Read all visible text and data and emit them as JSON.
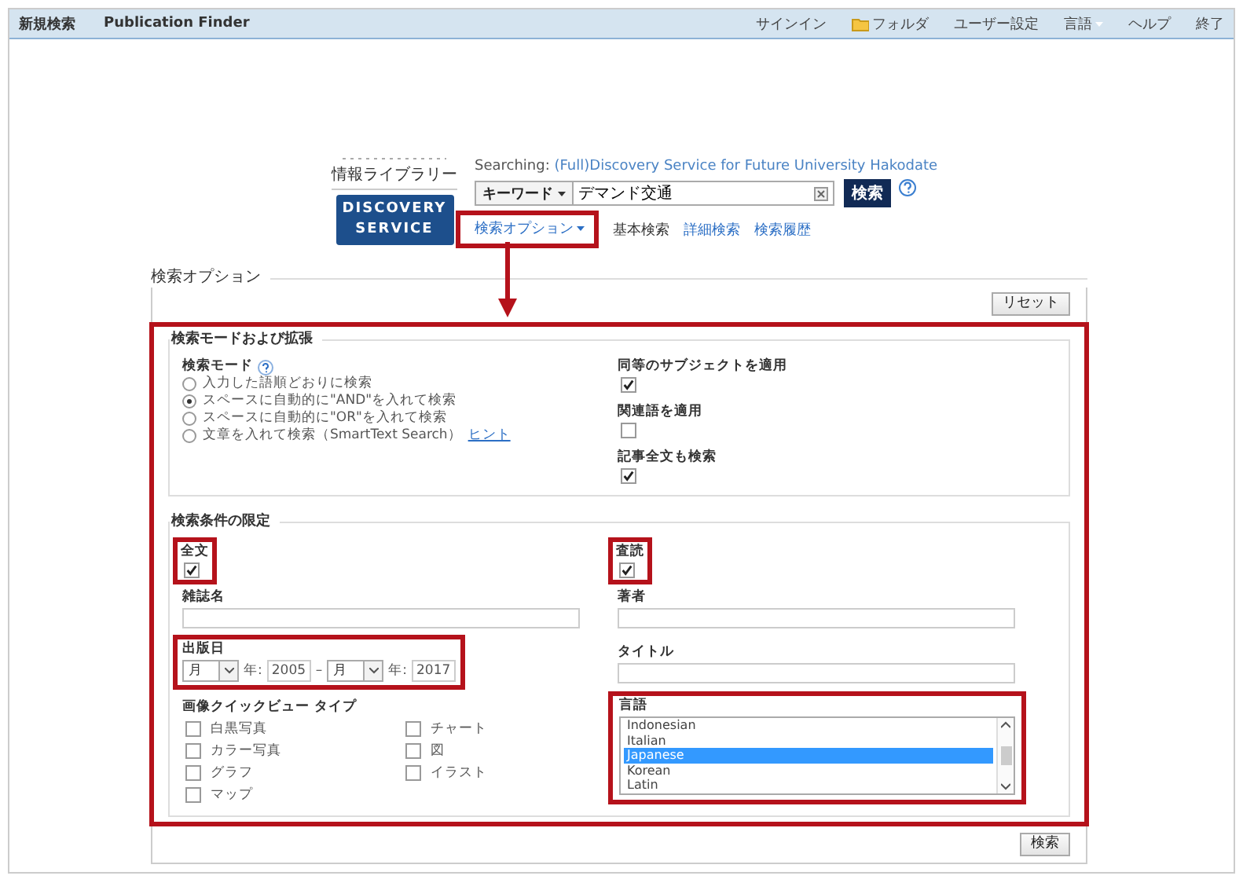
{
  "top_bar": {
    "left_links": [
      "新規検索",
      "Publication Finder"
    ],
    "right_links": [
      {
        "label": "サインイン",
        "kind": "plain"
      },
      {
        "label": "フォルダ",
        "kind": "folder"
      },
      {
        "label": "ユーザー設定",
        "kind": "plain"
      },
      {
        "label": "言語",
        "kind": "menu"
      },
      {
        "label": "ヘルプ",
        "kind": "plain"
      },
      {
        "label": "終了",
        "kind": "plain"
      }
    ]
  },
  "logo": {
    "line": "情報ライブラリー",
    "badge_lines": [
      "DISCOVERY",
      "SERVICE"
    ]
  },
  "search": {
    "searching_label": "Searching:",
    "database": "(Full)Discovery Service for Future University Hakodate",
    "field_selector": "キーワード",
    "value": "デマンド交通",
    "button": "検索",
    "links": [
      {
        "label": "検索オプション",
        "kind": "menu",
        "selected": false
      },
      {
        "label": "基本検索",
        "kind": "plain",
        "selected": true
      },
      {
        "label": "詳細検索",
        "kind": "plain",
        "selected": false
      },
      {
        "label": "検索履歴",
        "kind": "plain",
        "selected": false
      }
    ]
  },
  "options": {
    "title": "検索オプション",
    "reset_button": "リセット",
    "modes_section": {
      "title": "検索モードおよび拡張",
      "mode_label": "検索モード",
      "modes": [
        {
          "label": "入力した語順どおりに検索",
          "selected": false
        },
        {
          "label": "スペースに自動的に\"AND\"を入れて検索",
          "selected": true
        },
        {
          "label": "スペースに自動的に\"OR\"を入れて検索",
          "selected": false
        },
        {
          "label": "文章を入れて検索（SmartText Search）",
          "selected": false,
          "link": "ヒント"
        }
      ],
      "expanders": [
        {
          "label": "同等のサブジェクトを適用",
          "checked": true
        },
        {
          "label": "関連語を適用",
          "checked": false
        },
        {
          "label": "記事全文も検索",
          "checked": true
        }
      ]
    },
    "limits_section": {
      "title": "検索条件の限定",
      "full_text": {
        "label": "全文",
        "checked": true
      },
      "peer_reviewed": {
        "label": "査読",
        "checked": true
      },
      "journal_label": "雑誌名",
      "author_label": "著者",
      "title_label": "タイトル",
      "pub_date": {
        "label": "出版日",
        "from_month": "月",
        "from_year_label": "年:",
        "from_year": "2005",
        "separator": "–",
        "to_month": "月",
        "to_year_label": "年:",
        "to_year": "2017"
      },
      "image_types": {
        "label": "画像クイックビュー タイプ",
        "options": [
          {
            "label": "白黒写真",
            "checked": false
          },
          {
            "label": "カラー写真",
            "checked": false
          },
          {
            "label": "グラフ",
            "checked": false
          },
          {
            "label": "マップ",
            "checked": false
          },
          {
            "label": "チャート",
            "checked": false
          },
          {
            "label": "図",
            "checked": false
          },
          {
            "label": "イラスト",
            "checked": false
          }
        ]
      },
      "languages": {
        "label": "言語",
        "options": [
          {
            "label": "Indonesian",
            "selected": false
          },
          {
            "label": "Italian",
            "selected": false
          },
          {
            "label": "Japanese",
            "selected": true
          },
          {
            "label": "Korean",
            "selected": false
          },
          {
            "label": "Latin",
            "selected": false
          }
        ]
      }
    },
    "search_button": "検索"
  }
}
